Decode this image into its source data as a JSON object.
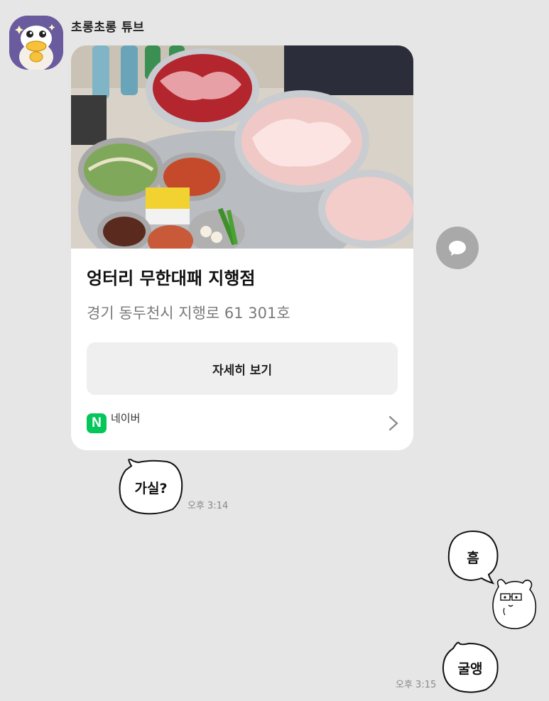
{
  "sender": {
    "name": "초롱초롱 튜브",
    "avatar_icon": "duck-character-icon"
  },
  "card": {
    "title": "엉터리 무한대패 지행점",
    "address": "경기 동두천시 지행로 61 301호",
    "button_label": "자세히 보기",
    "source_logo": "N",
    "source_name": "네이버"
  },
  "messages": [
    {
      "text": "가실?",
      "time": "오후 3:14",
      "side": "left"
    },
    {
      "text": "흠",
      "side": "right"
    },
    {
      "text": "굴앵",
      "time": "오후 3:15",
      "side": "right"
    }
  ],
  "colors": {
    "background": "#e6e6e6",
    "naver_green": "#03c75a",
    "avatar_bg": "#6a5a9e"
  }
}
